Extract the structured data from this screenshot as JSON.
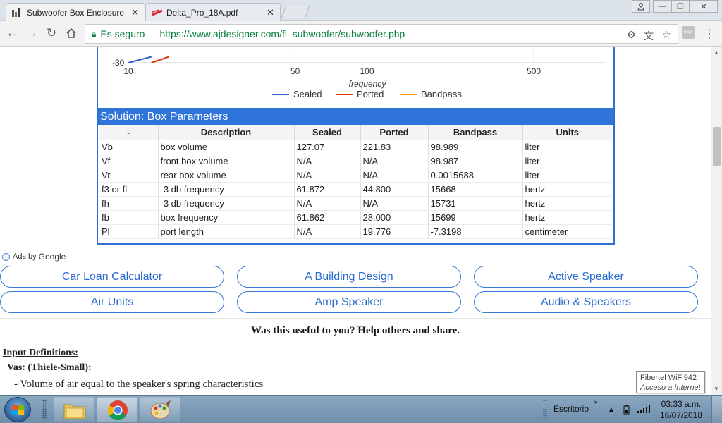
{
  "browser": {
    "tabs": [
      {
        "title": "Subwoofer Box Enclosure",
        "active": true
      },
      {
        "title": "Delta_Pro_18A.pdf",
        "active": false
      }
    ],
    "security_label": "Es seguro",
    "url": "https://www.ajdesigner.com/fl_subwoofer/subwoofer.php",
    "extension_label": "Flow"
  },
  "chart_data": {
    "type": "line",
    "xlabel": "frequency",
    "x_scale": "log",
    "x_ticks": [
      10,
      50,
      100,
      500
    ],
    "x_tick_labels": [
      "10",
      "50",
      "100",
      "500"
    ],
    "y_tick_labels": [
      "-30"
    ],
    "xlim": [
      10,
      1000
    ],
    "grid": true,
    "legend_position": "bottom",
    "series": [
      {
        "name": "Sealed",
        "color": "#3366cc",
        "x": [
          10,
          12.5
        ],
        "y": [
          -30,
          -25
        ]
      },
      {
        "name": "Ported",
        "color": "#dc3912",
        "x": [
          12.5,
          14.8
        ],
        "y": [
          -30,
          -25
        ]
      },
      {
        "name": "Bandpass",
        "color": "#ff9900",
        "x": [],
        "y": []
      }
    ]
  },
  "solution": {
    "title": "Solution: Box Parameters",
    "columns": [
      "-",
      "Description",
      "Sealed",
      "Ported",
      "Bandpass",
      "Units"
    ],
    "rows": [
      [
        "Vb",
        "box volume",
        "127.07",
        "221.83",
        "98.989",
        "liter"
      ],
      [
        "Vf",
        "front box volume",
        "N/A",
        "N/A",
        "98.987",
        "liter"
      ],
      [
        "Vr",
        "rear box volume",
        "N/A",
        "N/A",
        "0.0015688",
        "liter"
      ],
      [
        "f3 or fl",
        "-3 db frequency",
        "61.872",
        "44.800",
        "15668",
        "hertz"
      ],
      [
        "fh",
        "-3 db frequency",
        "N/A",
        "N/A",
        "15731",
        "hertz"
      ],
      [
        "fb",
        "box frequency",
        "61.862",
        "28.000",
        "15699",
        "hertz"
      ],
      [
        "Pl",
        "port length",
        "N/A",
        "19.776",
        "-7.3198",
        "centimeter"
      ]
    ]
  },
  "ads": {
    "label": "Ads by",
    "brand": "Google",
    "links": [
      "Car Loan Calculator",
      "A Building Design",
      "Active Speaker",
      "Air Units",
      "Amp Speaker",
      "Audio & Speakers"
    ]
  },
  "content": {
    "useful": "Was this useful to you? Help others and share.",
    "input_definitions": "Input Definitions:",
    "vas_heading": "Vas: (Thiele-Small):",
    "vas_definition": "- Volume of air equal to the speaker's spring characteristics"
  },
  "tooltip": {
    "title": "Fibertel WiFi942",
    "subtitle": "Acceso a Internet"
  },
  "taskbar": {
    "tray_label": "Escritorio",
    "time": "03:33 a.m.",
    "date": "16/07/2018"
  },
  "colors": {
    "accent": "#2f74d8",
    "link": "#2a6bd0",
    "secure": "#0b8043"
  }
}
